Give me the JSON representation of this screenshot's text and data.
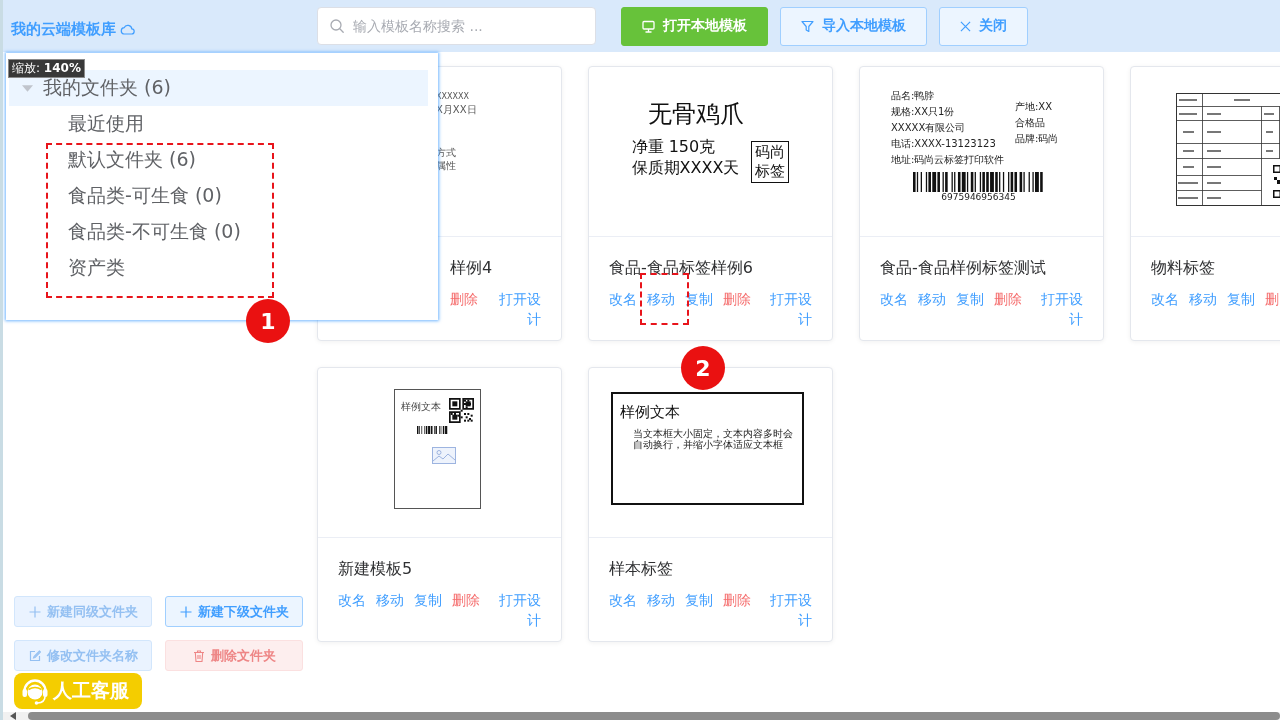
{
  "header": {
    "title": "我的云端模板库"
  },
  "search": {
    "placeholder": "输入模板名称搜索 ..."
  },
  "toolbar": [
    {
      "label": "打开本地模板",
      "kind": "primary"
    },
    {
      "label": "导入本地模板",
      "kind": "plain"
    },
    {
      "label": "关闭",
      "kind": "plain"
    }
  ],
  "folder_popup": {
    "zoom_tooltip": "缩放: **140%**",
    "tree": [
      {
        "label": "我的文件夹 (6)",
        "expanded": true,
        "selected": true,
        "children": [
          {
            "label": "最近使用",
            "selected": false
          },
          {
            "label": "默认文件夹 (6)",
            "selected": false
          },
          {
            "label": "食品类-可生食 (0)",
            "selected": false
          },
          {
            "label": "食品类-不可生食 (0)",
            "selected": false
          },
          {
            "label": "资产类",
            "selected": false
          }
        ]
      }
    ]
  },
  "folder_actions": [
    {
      "label": "新建同级文件夹",
      "kind": "default",
      "disabled": true
    },
    {
      "label": "新建下级文件夹",
      "kind": "default",
      "disabled": false
    },
    {
      "label": "修改文件夹名称",
      "kind": "default",
      "disabled": true
    },
    {
      "label": "删除文件夹",
      "kind": "danger",
      "disabled": true
    }
  ],
  "templates": [
    {
      "kind": "covered",
      "title": "样例4",
      "preview": {
        "kind": "fragments",
        "lines": [
          "XXXXXX",
          "X月XX日",
          "方式",
          "属性"
        ]
      },
      "actions": [
        {
          "label": "删除",
          "kind": "danger"
        },
        {
          "label": "打开设计",
          "kind": "open"
        }
      ]
    },
    {
      "kind": "plain",
      "title": "食品-食品标签样例6",
      "preview": {
        "kind": "product",
        "heading": "无骨鸡爪",
        "lines": [
          "净重 150克",
          "保质期XXXX天"
        ],
        "stamp": "码尚标签"
      },
      "actions": [
        {
          "label": "改名",
          "kind": "link"
        },
        {
          "label": "移动",
          "kind": "link"
        },
        {
          "label": "复制",
          "kind": "link"
        },
        {
          "label": "删除",
          "kind": "danger"
        },
        {
          "label": "打开设计",
          "kind": "open"
        }
      ]
    },
    {
      "kind": "plain",
      "title": "食品-食品样例标签测试",
      "preview": {
        "kind": "info",
        "left": [
          "品名:鸭脖",
          "规格:XX只1份",
          "XXXXX有限公司",
          "电话:XXXX-13123123",
          "地址:码尚云标签打印软件"
        ],
        "right": [
          "产地:XX",
          "合格品",
          "品牌:码尚"
        ],
        "barcode": "6975946956345"
      },
      "actions": [
        {
          "label": "改名",
          "kind": "link"
        },
        {
          "label": "移动",
          "kind": "link"
        },
        {
          "label": "复制",
          "kind": "link"
        },
        {
          "label": "删除",
          "kind": "danger"
        },
        {
          "label": "打开设计",
          "kind": "open"
        }
      ]
    },
    {
      "kind": "plain",
      "title": "物料标签",
      "preview": {
        "kind": "table"
      },
      "actions": [
        {
          "label": "改名",
          "kind": "link"
        },
        {
          "label": "移动",
          "kind": "link"
        },
        {
          "label": "复制",
          "kind": "link"
        },
        {
          "label": "删",
          "kind": "danger"
        }
      ]
    },
    {
      "kind": "plain",
      "title": "新建模板5",
      "preview": {
        "kind": "page",
        "caption": "样例文本"
      },
      "actions": [
        {
          "label": "改名",
          "kind": "link"
        },
        {
          "label": "移动",
          "kind": "link"
        },
        {
          "label": "复制",
          "kind": "link"
        },
        {
          "label": "删除",
          "kind": "danger"
        },
        {
          "label": "打开设计",
          "kind": "open"
        }
      ]
    },
    {
      "kind": "plain",
      "title": "样本标签",
      "preview": {
        "kind": "textbox",
        "heading": "样例文本",
        "body": "当文本框大小固定，文本内容多时会自动换行，并缩小字体适应文本框"
      },
      "actions": [
        {
          "label": "改名",
          "kind": "link"
        },
        {
          "label": "移动",
          "kind": "link"
        },
        {
          "label": "复制",
          "kind": "link"
        },
        {
          "label": "删除",
          "kind": "danger"
        },
        {
          "label": "打开设计",
          "kind": "open"
        }
      ]
    }
  ],
  "support_button": {
    "label": "人工客服"
  },
  "annotations": [
    {
      "number": "1"
    },
    {
      "number": "2"
    }
  ]
}
